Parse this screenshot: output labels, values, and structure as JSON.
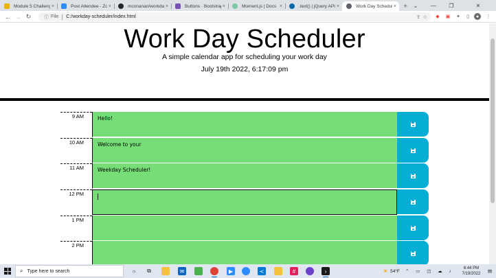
{
  "browser": {
    "tabs": [
      {
        "label": "Module 5 Challenge",
        "color": "#e8b400"
      },
      {
        "label": "Post Attendee - Zoom",
        "color": "#2d8cff"
      },
      {
        "label": "mconanan/workday-...",
        "color": "#24292f"
      },
      {
        "label": "Buttons · Bootstrap v5...",
        "color": "#7952b3"
      },
      {
        "label": "Moment.js | Docs",
        "color": "#7ec8a4"
      },
      {
        "label": ".text() | jQuery API Do...",
        "color": "#0769ad"
      },
      {
        "label": "Work Day Scheduler",
        "color": "#5f6368",
        "active": true
      }
    ],
    "new_tab_glyph": "+",
    "close_glyph": "×",
    "address": {
      "info_label": "File",
      "url": "C:/workday-scheduler/index.html"
    }
  },
  "header": {
    "title": "Work Day Scheduler",
    "lead": "A simple calendar app for scheduling your work day",
    "current_datetime": "July 19th 2022, 6:17:09 pm"
  },
  "timeblocks": [
    {
      "hour": "9 AM",
      "text": "Hello!"
    },
    {
      "hour": "10 AM",
      "text": "Welcome to your"
    },
    {
      "hour": "11 AM",
      "text": "Weekday Scheduler!"
    },
    {
      "hour": "12 PM",
      "text": "",
      "focused": true
    },
    {
      "hour": "1 PM",
      "text": ""
    },
    {
      "hour": "2 PM",
      "text": ""
    }
  ],
  "colors": {
    "future_block": "#77dd77",
    "save_button": "#06aed5"
  },
  "taskbar": {
    "search_placeholder": "Type here to search",
    "weather": "54°F",
    "time": "6:44 PM",
    "date": "7/19/2022"
  }
}
